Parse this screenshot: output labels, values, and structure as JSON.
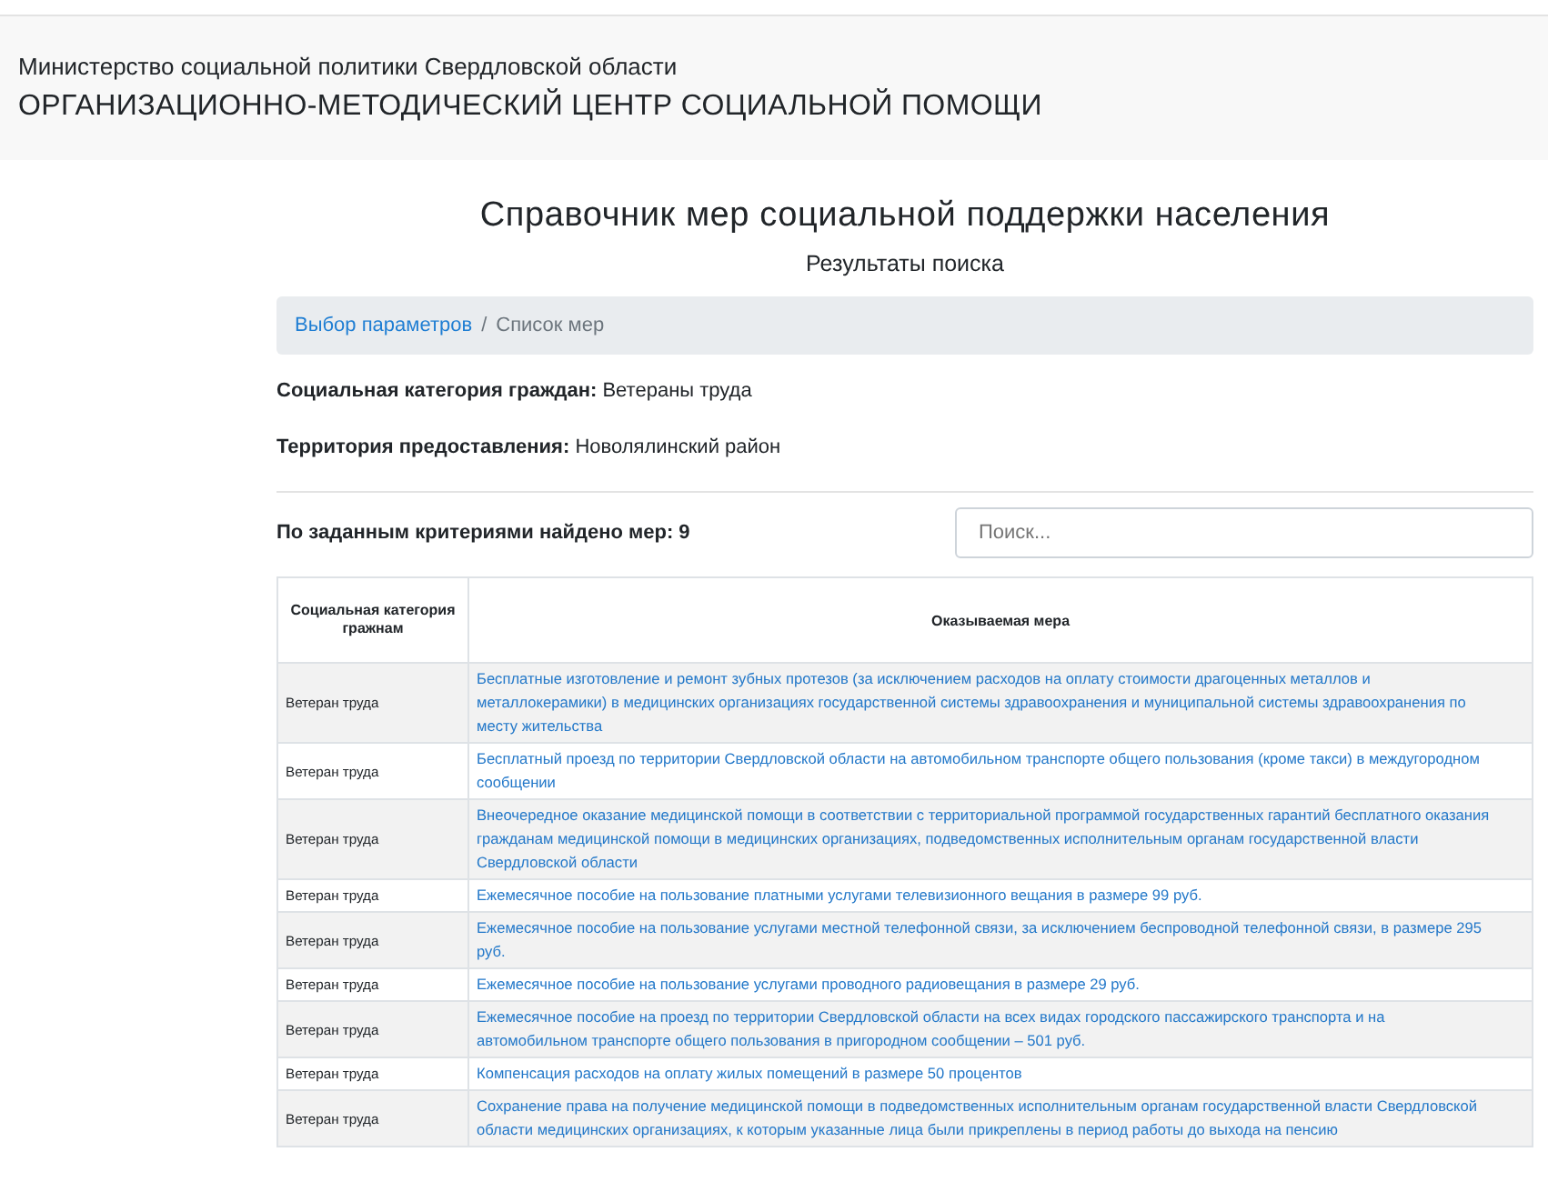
{
  "header": {
    "ministry": "Министерство социальной политики Свердловской области",
    "center": "ОРГАНИЗАЦИОННО-МЕТОДИЧЕСКИЙ ЦЕНТР СОЦИАЛЬНОЙ ПОМОЩИ"
  },
  "title": "Справочник мер социальной поддержки населения",
  "subtitle": "Результаты поиска",
  "breadcrumb": [
    {
      "label": "Выбор параметров",
      "link": true
    },
    {
      "label": "Список мер",
      "link": false
    }
  ],
  "breadcrumb_separator": "/",
  "filters": [
    {
      "label": "Социальная категория граждан:",
      "value": "Ветераны труда"
    },
    {
      "label": "Территория предоставления:",
      "value": "Новолялинский район"
    }
  ],
  "found": "По заданным критериями найдено мер: 9",
  "search": {
    "placeholder": "Поиск..."
  },
  "table": {
    "columns": [
      "Социальная категория гражнам",
      "Оказываемая мера"
    ],
    "rows": [
      {
        "category": "Ветеран труда",
        "measure": "Бесплатные изготовление и ремонт зубных протезов (за исключением расходов на оплату стоимости драгоценных металлов и металлокерамики) в медицинских организациях государственной системы здравоохранения и муниципальной системы здравоохранения по месту жительства"
      },
      {
        "category": "Ветеран труда",
        "measure": "Бесплатный проезд по территории Свердловской области на автомобильном транспорте общего пользования (кроме такси) в междугородном сообщении"
      },
      {
        "category": "Ветеран труда",
        "measure": "Внеочередное оказание медицинской помощи в соответствии с территориальной программой государственных гарантий бесплатного оказания гражданам медицинской помощи в медицинских организациях, подведомственных исполнительным органам государственной власти Свердловской области"
      },
      {
        "category": "Ветеран труда",
        "measure": "Ежемесячное пособие на пользование платными услугами телевизионного вещания в размере 99 руб."
      },
      {
        "category": "Ветеран труда",
        "measure": "Ежемесячное пособие на пользование услугами местной телефонной связи, за исключением беспроводной телефонной связи, в размере 295 руб."
      },
      {
        "category": "Ветеран труда",
        "measure": "Ежемесячное пособие на пользование услугами проводного радиовещания в размере 29 руб."
      },
      {
        "category": "Ветеран труда",
        "measure": "Ежемесячное пособие на проезд по территории Свердловской области на всех видах городского пассажирского транспорта и на автомобильном транспорте общего пользования в пригородном сообщении – 501 руб."
      },
      {
        "category": "Ветеран труда",
        "measure": "Компенсация расходов на оплату жилых помещений в размере 50 процентов"
      },
      {
        "category": "Ветеран труда",
        "measure": "Сохранение права на получение медицинской помощи в подведомственных исполнительным органам государственной власти Свердловской области медицинских организациях, к которым указанные лица были прикреплены в период работы до выхода на пенсию"
      }
    ]
  }
}
